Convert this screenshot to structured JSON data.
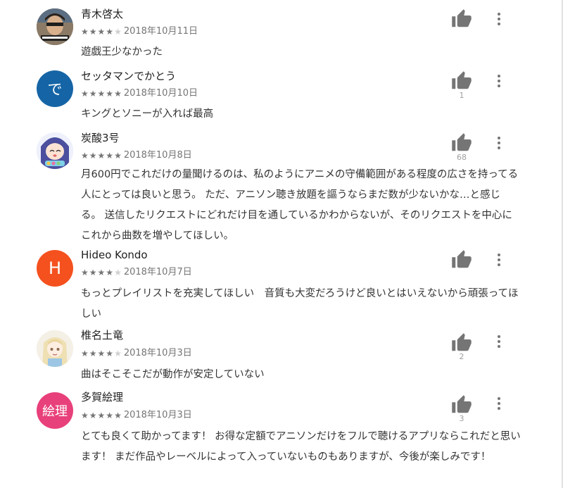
{
  "reviews": [
    {
      "author": "青木啓太",
      "rating": 4,
      "stars": [
        "★",
        "★",
        "★",
        "★",
        "★"
      ],
      "date": "2018年10月11日",
      "likes": "",
      "body": "遊戯王少なかった",
      "avatar": {
        "type": "photo",
        "text": "",
        "color": "#6b5a4a"
      }
    },
    {
      "author": "セッタマンでかとう",
      "rating": 5,
      "stars": [
        "★",
        "★",
        "★",
        "★",
        "★"
      ],
      "date": "2018年10月10日",
      "likes": "1",
      "body": "キングとソニーが入れば最高",
      "avatar": {
        "type": "letter",
        "text": "で",
        "color": "#1565a6"
      }
    },
    {
      "author": "炭酸3号",
      "rating": 5,
      "stars": [
        "★",
        "★",
        "★",
        "★",
        "★"
      ],
      "date": "2018年10月8日",
      "likes": "68",
      "body": "月600円でこれだけの量聞けるのは、私のようにアニメの守備範囲がある程度の広さを持ってる人にとっては良いと思う。 ただ、アニソン聴き放題を謳うならまだ数が少ないかな…と感じる。 送信したリクエストにどれだけ目を通しているかわからないが、そのリクエストを中心にこれから曲数を増やしてほしい。",
      "avatar": {
        "type": "anime",
        "text": "",
        "color": "#5f6fb3"
      }
    },
    {
      "author": "Hideo Kondo",
      "rating": 4,
      "stars": [
        "★",
        "★",
        "★",
        "★",
        "★"
      ],
      "date": "2018年10月7日",
      "likes": "",
      "body": "もっとプレイリストを充実してほしい　音質も大変だろうけど良いとはいえないから頑張ってほしい",
      "avatar": {
        "type": "letter",
        "text": "H",
        "color": "#f4511e"
      }
    },
    {
      "author": "椎名土竜",
      "rating": 4,
      "stars": [
        "★",
        "★",
        "★",
        "★",
        "★"
      ],
      "date": "2018年10月3日",
      "likes": "2",
      "body": "曲はそこそこだが動作が安定していない",
      "avatar": {
        "type": "anime2",
        "text": "",
        "color": "#e8d9b0"
      }
    },
    {
      "author": "多賀絵理",
      "rating": 5,
      "stars": [
        "★",
        "★",
        "★",
        "★",
        "★"
      ],
      "date": "2018年10月3日",
      "likes": "3",
      "body": "とても良くて助かってます！ お得な定額でアニソンだけをフルで聴けるアプリならこれだと思います！ まだ作品やレーベルによって入っていないものもありますが、今後が楽しみです！",
      "avatar": {
        "type": "letter",
        "text": "絵理",
        "color": "#e8407a"
      }
    }
  ],
  "icons": {
    "like": "thumb-up-icon",
    "more": "more-vert-icon"
  },
  "colors": {
    "icon": "#757575",
    "star_on": "#757575",
    "star_off": "#cfcfcf"
  }
}
